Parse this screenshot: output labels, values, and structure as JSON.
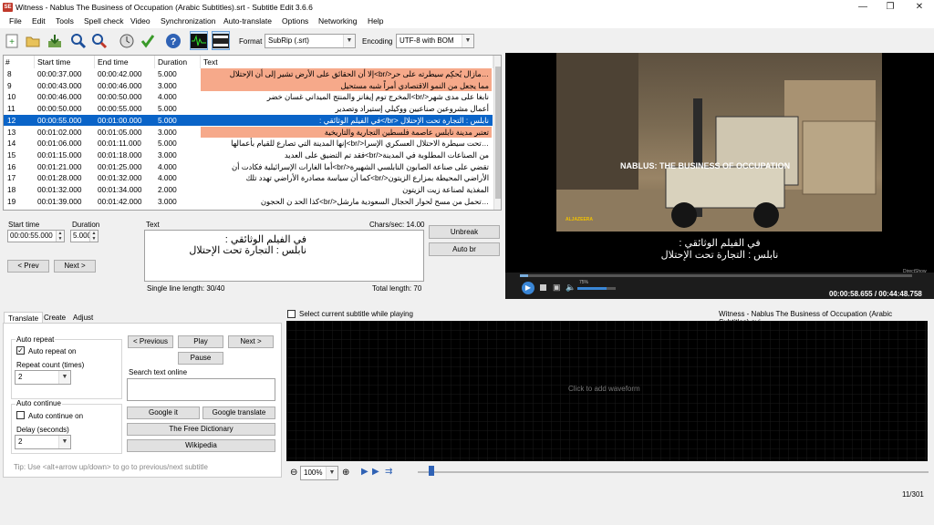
{
  "window": {
    "title": "Witness - Nablus The Business of Occupation (Arabic Subtitles).srt - Subtitle Edit 3.6.6",
    "app_icon": "SE"
  },
  "menu": [
    "File",
    "Edit",
    "Tools",
    "Spell check",
    "Video",
    "Synchronization",
    "Auto-translate",
    "Options",
    "Networking",
    "Help"
  ],
  "toolbar": {
    "format_label": "Format",
    "format_value": "SubRip (.srt)",
    "encoding_label": "Encoding",
    "encoding_value": "UTF-8 with BOM"
  },
  "grid": {
    "headers": [
      "#",
      "Start time",
      "End time",
      "Duration",
      "Text"
    ],
    "rows": [
      {
        "n": "8",
        "start": "00:00:37.000",
        "end": "00:00:42.000",
        "dur": "5.000",
        "text": "…مازال يُحكِم سيطرته على حر</br>إلا أن الحقائق على الأرض تشير إلى أن الإحتلال",
        "hl": "pink"
      },
      {
        "n": "9",
        "start": "00:00:43.000",
        "end": "00:00:46.000",
        "dur": "3.000",
        "text": "مما يجعل من النمو الاقتصادي أمراً شبه مستحيل",
        "hl": "pink"
      },
      {
        "n": "10",
        "start": "00:00:46.000",
        "end": "00:00:50.000",
        "dur": "4.000",
        "text": "نابغا على مدى شهر</br>المخرج توم إيفانز والمنتج الميداني غسان خضر",
        "hl": ""
      },
      {
        "n": "11",
        "start": "00:00:50.000",
        "end": "00:00:55.000",
        "dur": "5.000",
        "text": "أعمال مشروعين صناعيين ووكيلي إستيراد وتصدير",
        "hl": ""
      },
      {
        "n": "12",
        "start": "00:00:55.000",
        "end": "00:01:00.000",
        "dur": "5.000",
        "text": "نابلس : التجارة تحت الإحتلال     <br/>في الفيلم الوثائقي :",
        "hl": "sel"
      },
      {
        "n": "13",
        "start": "00:01:02.000",
        "end": "00:01:05.000",
        "dur": "3.000",
        "text": "تعتبر مدينة نابلس عاصمة فلسطين التجارية والتاريخية",
        "hl": "pink"
      },
      {
        "n": "14",
        "start": "00:01:06.000",
        "end": "00:01:11.000",
        "dur": "5.000",
        "text": "…تحت سيطرة الاحتلال العسكري الإسرا</br>إنها المدينة التي تصارع للقيام بأعمالها",
        "hl": ""
      },
      {
        "n": "15",
        "start": "00:01:15.000",
        "end": "00:01:18.000",
        "dur": "3.000",
        "text": "من الصناعات المطلوبة في المدينة</br>فقد تم التضيق على العديد",
        "hl": ""
      },
      {
        "n": "16",
        "start": "00:01:21.000",
        "end": "00:01:25.000",
        "dur": "4.000",
        "text": "تقضي على صناعة الصابون النابلسي الشهيرة</br>أما الغارات الإسرائيلية فكادت أن",
        "hl": ""
      },
      {
        "n": "17",
        "start": "00:01:28.000",
        "end": "00:01:32.000",
        "dur": "4.000",
        "text": "الأراضي المحيطة بمزارع الزيتون</br>كما أن سياسة مصادرة الأراضي تهدد تلك",
        "hl": ""
      },
      {
        "n": "18",
        "start": "00:01:32.000",
        "end": "00:01:34.000",
        "dur": "2.000",
        "text": "المغذية لصناعة زيت الزيتون",
        "hl": ""
      },
      {
        "n": "19",
        "start": "00:01:39.000",
        "end": "00:01:42.000",
        "dur": "3.000",
        "text": "…تحمل من مسح لحوار الحجال السعودية مارشل</br>كذا الحد ن الحجون",
        "hl": ""
      }
    ]
  },
  "editor": {
    "start_label": "Start time",
    "start_value": "00:00:55.000",
    "dur_label": "Duration",
    "dur_value": "5.000",
    "text_label": "Text",
    "chars_sec": "Chars/sec: 14.00",
    "line1": "في الفيلم الوثائقي :",
    "line2": "نابلس : التجارة تحت الإحتلال",
    "prev": "< Prev",
    "next": "Next >",
    "unbreak": "Unbreak",
    "autobr": "Auto br",
    "single_line": "Single line length: 30/40",
    "total_len": "Total length: 70"
  },
  "video": {
    "overlay": "NABLUS: THE BUSINESS OF OCCUPATION",
    "logo": "ALJAZEERA",
    "sub1": "في الفيلم الوثائقي :",
    "sub2": "نابلس : التجارة تحت الإحتلال",
    "time": "00:00:58.655 / 00:44:48.758",
    "volume": "75%",
    "brand": "DirectShow"
  },
  "tabs": [
    "Translate",
    "Create",
    "Adjust"
  ],
  "translate": {
    "auto_repeat": "Auto repeat",
    "auto_repeat_on": "Auto repeat on",
    "repeat_count": "Repeat count (times)",
    "repeat_value": "2",
    "auto_continue": "Auto continue",
    "auto_continue_on": "Auto continue on",
    "delay": "Delay (seconds)",
    "delay_value": "2",
    "previous": "< Previous",
    "play": "Play",
    "next": "Next >",
    "pause": "Pause",
    "search_label": "Search text online",
    "google_it": "Google it",
    "google_translate": "Google translate",
    "free_dict": "The Free Dictionary",
    "wikipedia": "Wikipedia",
    "tip": "Tip: Use <alt+arrow up/down> to go to previous/next subtitle"
  },
  "waveform": {
    "select_label": "Select current subtitle while playing",
    "filename": "Witness - Nablus The Business of Occupation (Arabic Subtitles).avi",
    "click_hint": "Click to add waveform",
    "zoom": "100%"
  },
  "status": {
    "position": "11/301"
  },
  "colors": {
    "pink": "#f6a98a",
    "selected": "#0a64c8"
  }
}
